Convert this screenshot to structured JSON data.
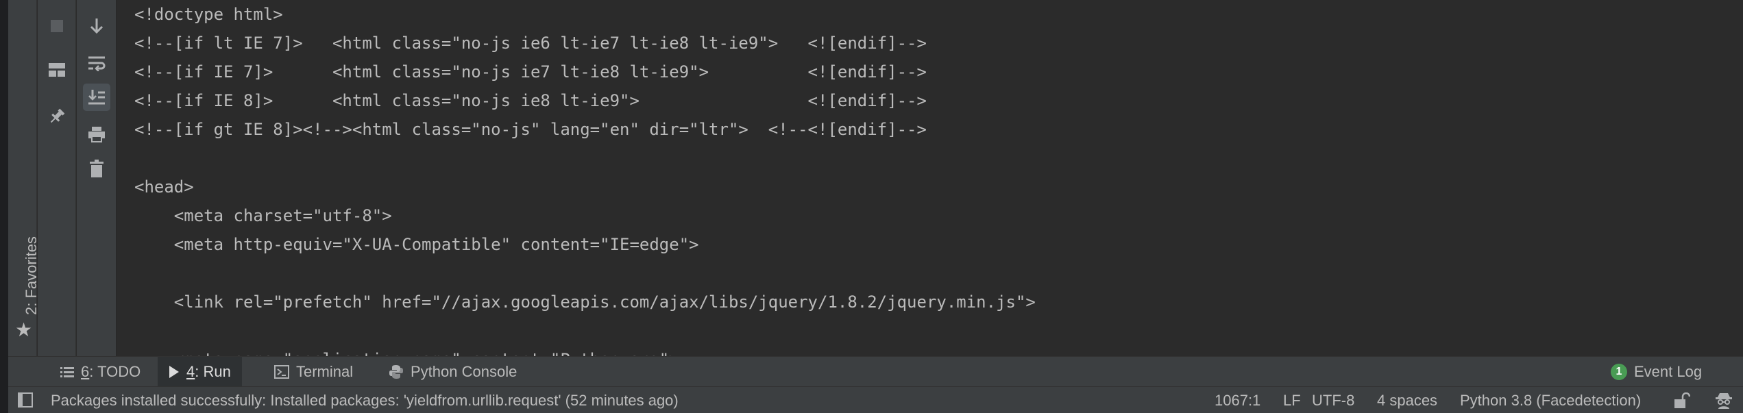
{
  "favorites": {
    "label": "2: Favorites",
    "star_icon": "★"
  },
  "toolbar": {
    "stop_icon": "stop-icon",
    "layout_icon": "layout-icon",
    "pin_icon": "pin-icon",
    "scroll_down_icon": "scroll-down-icon",
    "soft_wrap_icon": "soft-wrap-icon",
    "scroll_to_end_icon": "scroll-to-end-icon",
    "print_icon": "print-icon",
    "trash_icon": "trash-icon"
  },
  "console": {
    "lines": [
      "<!doctype html>",
      "<!--[if lt IE 7]>   <html class=\"no-js ie6 lt-ie7 lt-ie8 lt-ie9\">   <![endif]-->",
      "<!--[if IE 7]>      <html class=\"no-js ie7 lt-ie8 lt-ie9\">          <![endif]-->",
      "<!--[if IE 8]>      <html class=\"no-js ie8 lt-ie9\">                 <![endif]-->",
      "<!--[if gt IE 8]><!--><html class=\"no-js\" lang=\"en\" dir=\"ltr\">  <!--<![endif]-->",
      "",
      "<head>",
      "    <meta charset=\"utf-8\">",
      "    <meta http-equiv=\"X-UA-Compatible\" content=\"IE=edge\">",
      "",
      "    <link rel=\"prefetch\" href=\"//ajax.googleapis.com/ajax/libs/jquery/1.8.2/jquery.min.js\">",
      "",
      "    <meta name=\"application-name\" content=\"Python.org\">"
    ]
  },
  "bottom_tabs": {
    "todo": {
      "num": "6",
      "rest": ": TODO"
    },
    "run": {
      "num": "4",
      "rest": ": Run"
    },
    "terminal": {
      "label": "Terminal"
    },
    "python_console": {
      "label": "Python Console"
    },
    "event_log": {
      "count": "1",
      "label": "Event Log"
    }
  },
  "status_bar": {
    "message": "Packages installed successfully: Installed packages: 'yieldfrom.urllib.request' (52 minutes ago)",
    "position": "1067:1",
    "line_separator": "LF",
    "encoding": "UTF-8",
    "indent": "4 spaces",
    "interpreter": "Python 3.8 (Facedetection)"
  },
  "colors": {
    "background": "#2b2b2b",
    "panel": "#3c3f41",
    "text": "#bbbbbb",
    "badge": "#499c54"
  }
}
